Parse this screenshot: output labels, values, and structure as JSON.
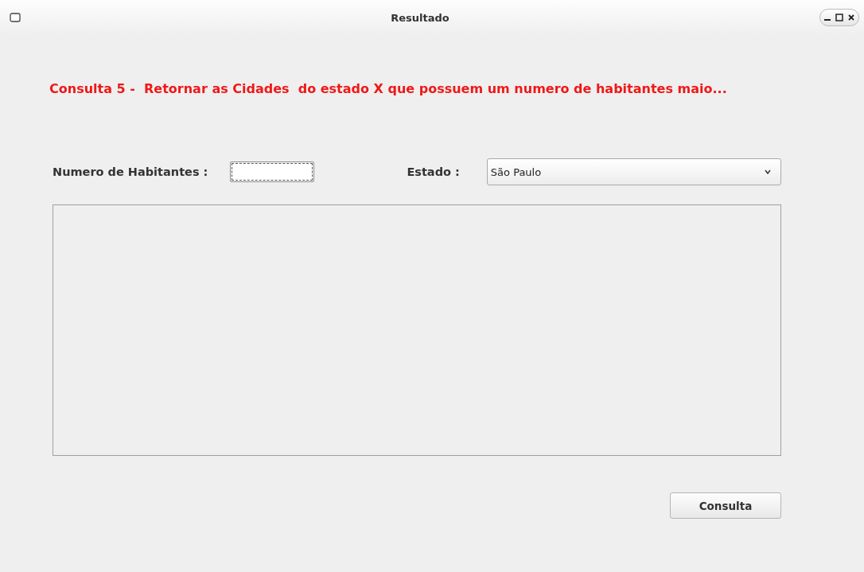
{
  "window": {
    "title": "Resultado"
  },
  "heading": "Consulta 5 -  Retornar as Cidades  do estado X que possuem um numero de habitantes maio...",
  "form": {
    "habitantes_label": "Numero de Habitantes :",
    "habitantes_focused": true,
    "estado_label": "Estado :",
    "estado_value": "São Paulo"
  },
  "buttons": [
    "Consulta"
  ]
}
